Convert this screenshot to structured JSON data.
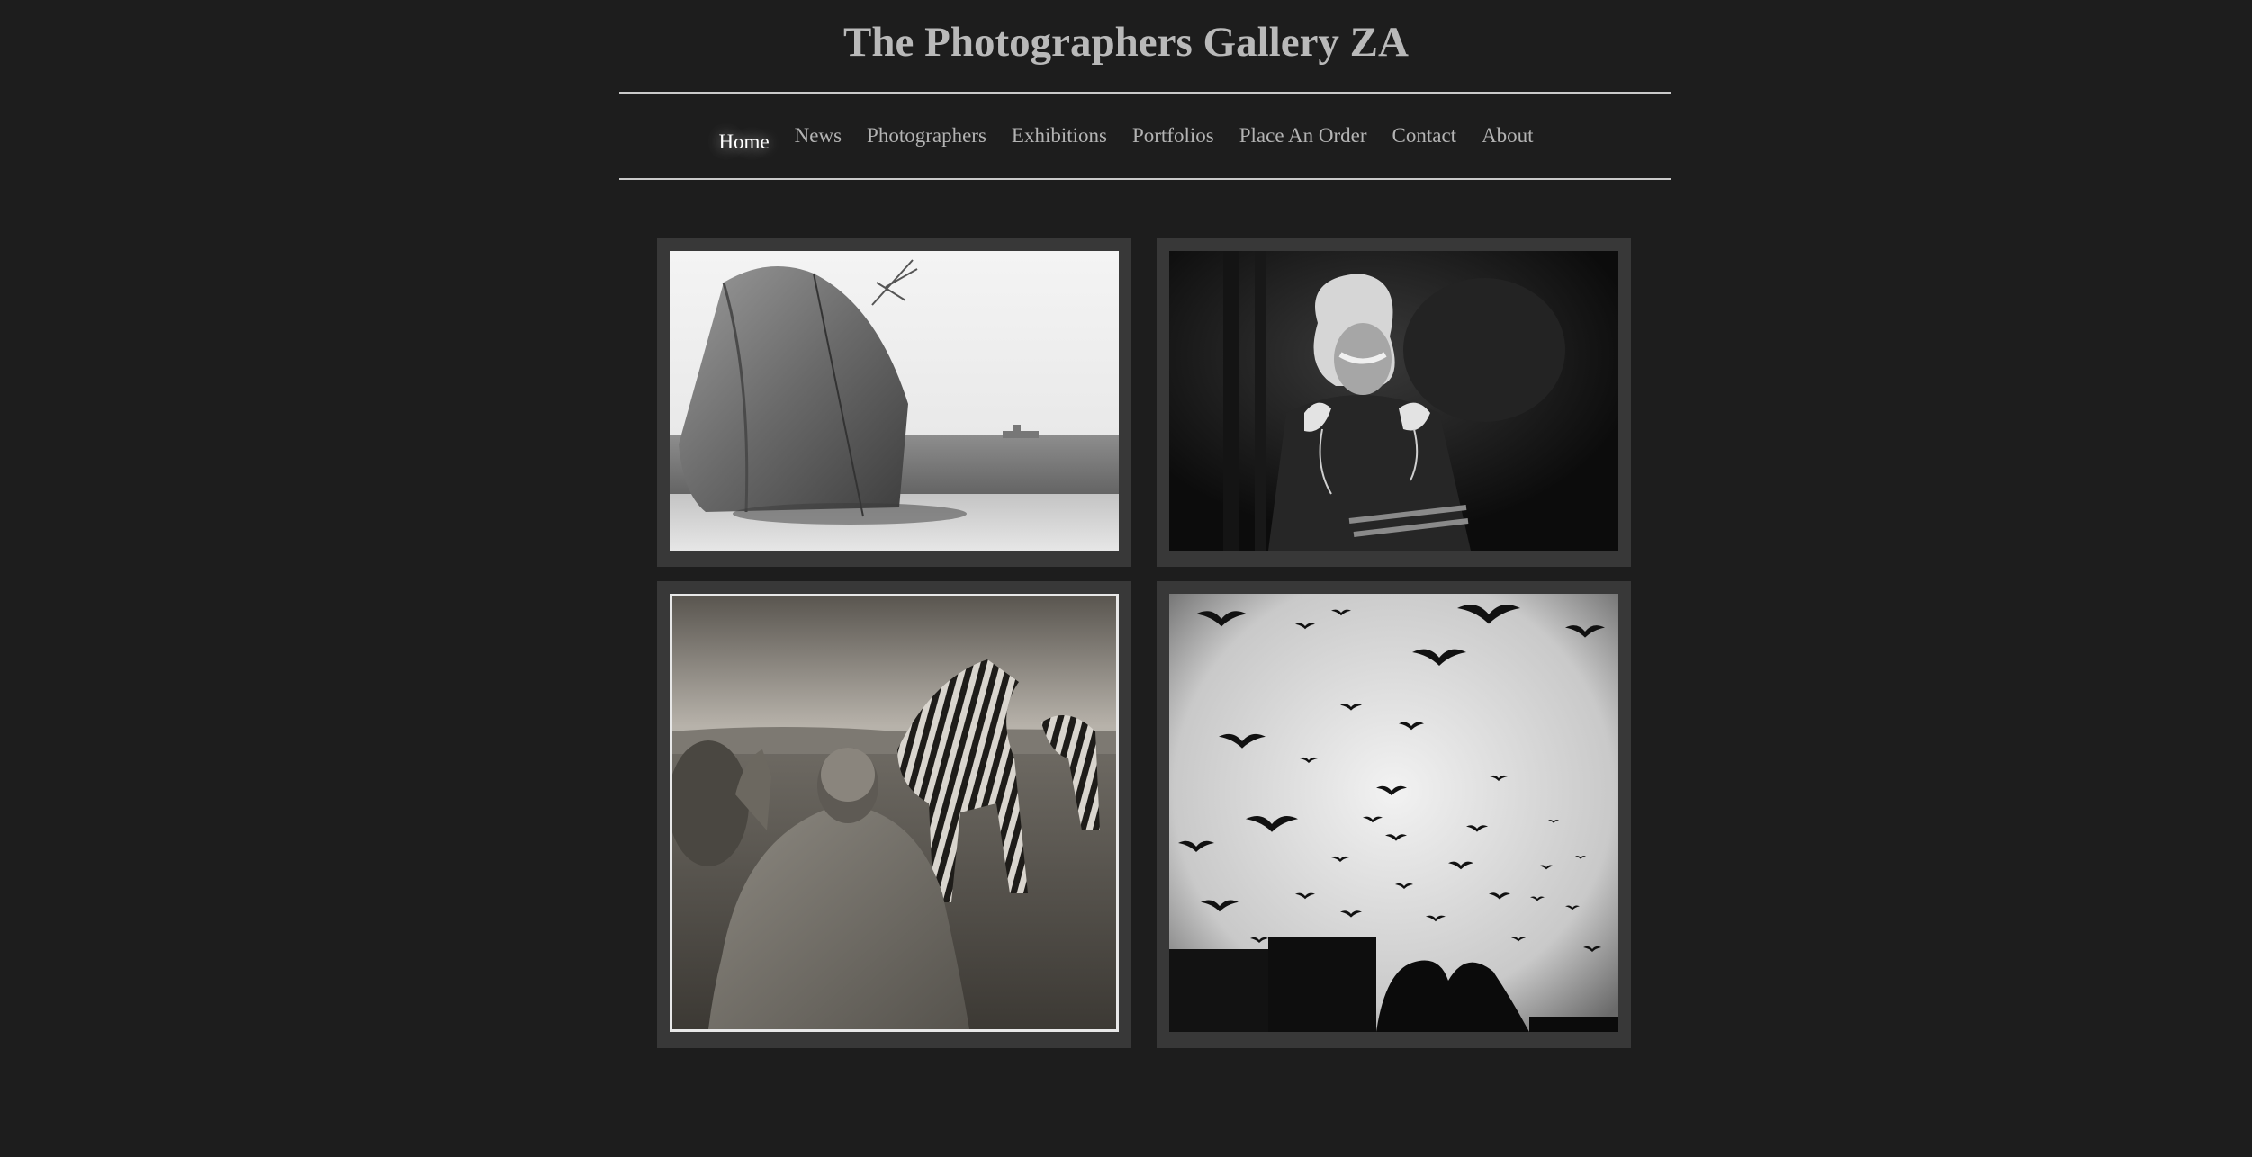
{
  "site": {
    "title": "The Photographers Gallery ZA"
  },
  "nav": {
    "items": [
      {
        "label": "Home",
        "active": true
      },
      {
        "label": "News",
        "active": false
      },
      {
        "label": "Photographers",
        "active": false
      },
      {
        "label": "Exhibitions",
        "active": false
      },
      {
        "label": "Portfolios",
        "active": false
      },
      {
        "label": "Place An Order",
        "active": false
      },
      {
        "label": "Contact",
        "active": false
      },
      {
        "label": "About",
        "active": false
      }
    ]
  },
  "gallery": {
    "tiles": [
      {
        "subject": "shipwreck-on-beach",
        "tone": "light-monochrome"
      },
      {
        "subject": "girl-with-white-rats",
        "tone": "dark-monochrome"
      },
      {
        "subject": "man-with-zebras",
        "tone": "sepia-monochrome"
      },
      {
        "subject": "birds-in-sky",
        "tone": "high-contrast-monochrome"
      }
    ]
  },
  "colors": {
    "background": "#1d1d1d",
    "title": "#b9b9b9",
    "nav_text": "#b3b3b3",
    "nav_active": "#ffffff",
    "rule": "#c9c9c9",
    "tile_frame": "#383838"
  }
}
